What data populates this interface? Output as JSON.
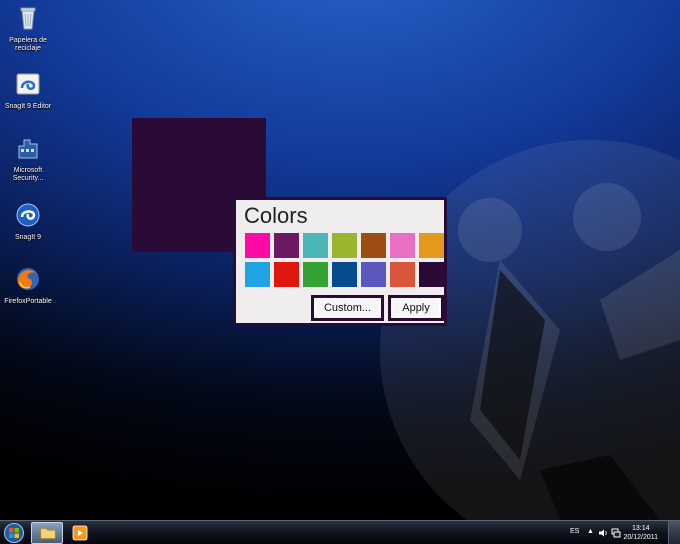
{
  "desktop": {
    "icons": [
      {
        "label": "Papelera de\nreciclaje",
        "icon": "recycle-bin-icon"
      },
      {
        "label": "SnagIt 9 Editor",
        "icon": "snagit-editor-icon"
      },
      {
        "label": "Microsoft\nSecurity...",
        "icon": "microsoft-security-icon"
      },
      {
        "label": "SnagIt 9",
        "icon": "snagit-icon"
      },
      {
        "label": "FirefoxPortable",
        "icon": "firefox-icon"
      }
    ],
    "preview_color": "#2a0b35"
  },
  "dialog": {
    "title": "Colors",
    "swatches": [
      "#ff0aa5",
      "#6b1a63",
      "#4ab6b8",
      "#9bb52f",
      "#9c4e13",
      "#e86fc4",
      "#e39a1c",
      "#21a3e3",
      "#e0170f",
      "#33a334",
      "#044c8c",
      "#5a58bd",
      "#d9553c",
      "#2a0b35"
    ],
    "custom_label": "Custom...",
    "apply_label": "Apply",
    "border_color": "#2a0b35"
  },
  "taskbar": {
    "language": "ES",
    "time": "13:14",
    "date": "20/12/2011"
  }
}
